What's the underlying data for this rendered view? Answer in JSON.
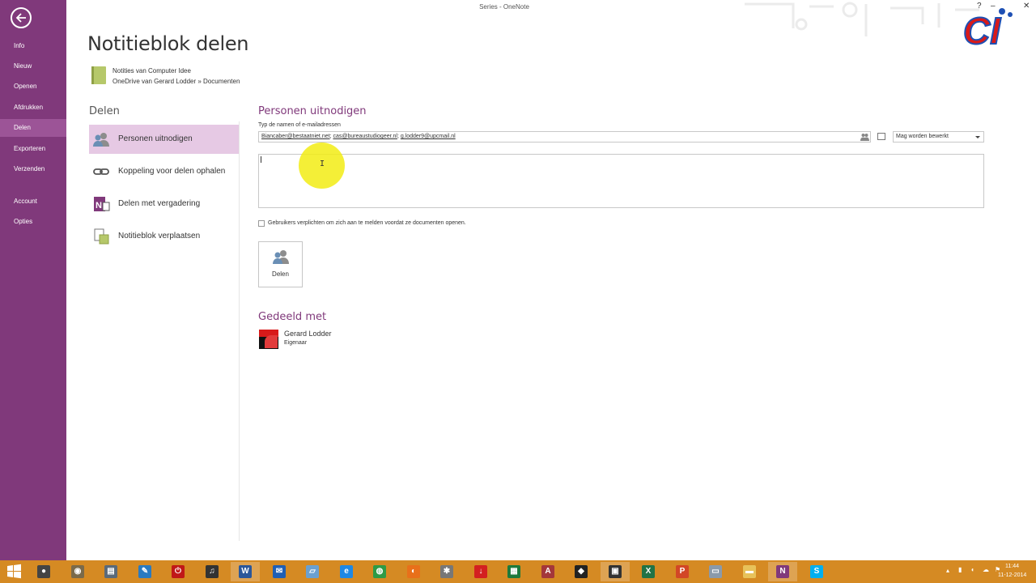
{
  "window": {
    "title": "Series - OneNote",
    "help": "?",
    "minimize": "–",
    "close": "✕"
  },
  "nav": {
    "items": [
      {
        "label": "Info"
      },
      {
        "label": "Nieuw"
      },
      {
        "label": "Openen"
      },
      {
        "label": "Afdrukken"
      },
      {
        "label": "Delen",
        "active": true
      },
      {
        "label": "Exporteren"
      },
      {
        "label": "Verzenden"
      },
      {
        "label": "Account"
      },
      {
        "label": "Opties"
      }
    ]
  },
  "logo": {
    "text": "CI"
  },
  "page": {
    "title": "Notitieblok delen",
    "notebook_name": "Notities van Computer Idee",
    "notebook_path": "OneDrive van Gerard Lodder » Documenten"
  },
  "share": {
    "heading": "Delen",
    "options": [
      {
        "label": "Personen uitnodigen",
        "icon": "people-icon",
        "active": true
      },
      {
        "label": "Koppeling voor delen ophalen",
        "icon": "link-icon"
      },
      {
        "label": "Delen met vergadering",
        "icon": "onenote-meeting-icon"
      },
      {
        "label": "Notitieblok verplaatsen",
        "icon": "move-notebook-icon"
      }
    ]
  },
  "invite": {
    "title": "Personen uitnodigen",
    "field_label": "Typ de namen of e-mailadressen",
    "recipients": [
      "Biancaber@bestaatniet.net",
      "cas@bureaustudiogeer.nl",
      "g.lodder9@upcmail.nl"
    ],
    "separator": "; ",
    "permission": "Mag worden bewerkt",
    "message": "",
    "require_signin_label": "Gebruikers verplichten om zich aan te melden voordat ze documenten openen.",
    "require_signin_checked": false,
    "share_button": "Delen"
  },
  "shared_with": {
    "title": "Gedeeld met",
    "people": [
      {
        "name": "Gerard Lodder",
        "role": "Eigenaar"
      }
    ]
  },
  "colors": {
    "accent": "#80397b",
    "nav_active": "#9c5497",
    "option_active": "#e6c9e4",
    "taskbar": "#d58a23",
    "highlight": "#f2ec14"
  },
  "taskbar": {
    "apps": [
      {
        "name": "camera-app-icon",
        "color": "#444444",
        "glyph": "●"
      },
      {
        "name": "generic-app-icon",
        "color": "#7a6a4a",
        "glyph": "◉"
      },
      {
        "name": "folder-app-icon",
        "color": "#5a6a7a",
        "glyph": "▤"
      },
      {
        "name": "pen-app-icon",
        "color": "#2a7ac0",
        "glyph": "✎"
      },
      {
        "name": "power-app-icon",
        "color": "#c01818",
        "glyph": "⏻"
      },
      {
        "name": "headphones-app-icon",
        "color": "#333333",
        "glyph": "♫"
      },
      {
        "name": "word-icon",
        "color": "#2b579a",
        "glyph": "W",
        "open": true
      },
      {
        "name": "outlook-app-icon",
        "color": "#1f5fb5",
        "glyph": "✉"
      },
      {
        "name": "notes-app-icon",
        "color": "#6aa0d0",
        "glyph": "▱"
      },
      {
        "name": "internet-explorer-icon",
        "color": "#1e88e5",
        "glyph": "e"
      },
      {
        "name": "chrome-icon",
        "color": "#2e9b46",
        "glyph": "◍"
      },
      {
        "name": "firefox-icon",
        "color": "#e8701a",
        "glyph": "◐"
      },
      {
        "name": "tool-app-icon",
        "color": "#777777",
        "glyph": "✱"
      },
      {
        "name": "download-app-icon",
        "color": "#d32020",
        "glyph": "↓"
      },
      {
        "name": "excel-green-icon",
        "color": "#1d7a3c",
        "glyph": "▦"
      },
      {
        "name": "access-icon",
        "color": "#a4373a",
        "glyph": "A"
      },
      {
        "name": "black-app-icon",
        "color": "#222222",
        "glyph": "◆"
      },
      {
        "name": "terminal-app-icon",
        "color": "#333333",
        "glyph": "▣",
        "open": true
      },
      {
        "name": "excel-icon",
        "color": "#217346",
        "glyph": "X"
      },
      {
        "name": "powerpoint-icon",
        "color": "#d24726",
        "glyph": "P"
      },
      {
        "name": "monitor-app-icon",
        "color": "#8a9aaa",
        "glyph": "▭"
      },
      {
        "name": "explorer-icon",
        "color": "#e8c25a",
        "glyph": "▬"
      },
      {
        "name": "onenote-icon",
        "color": "#80397b",
        "glyph": "N",
        "open": true
      },
      {
        "name": "skype-icon",
        "color": "#00aff0",
        "glyph": "S"
      }
    ],
    "clock_time": "11:44",
    "clock_date": "11-12-2014"
  }
}
